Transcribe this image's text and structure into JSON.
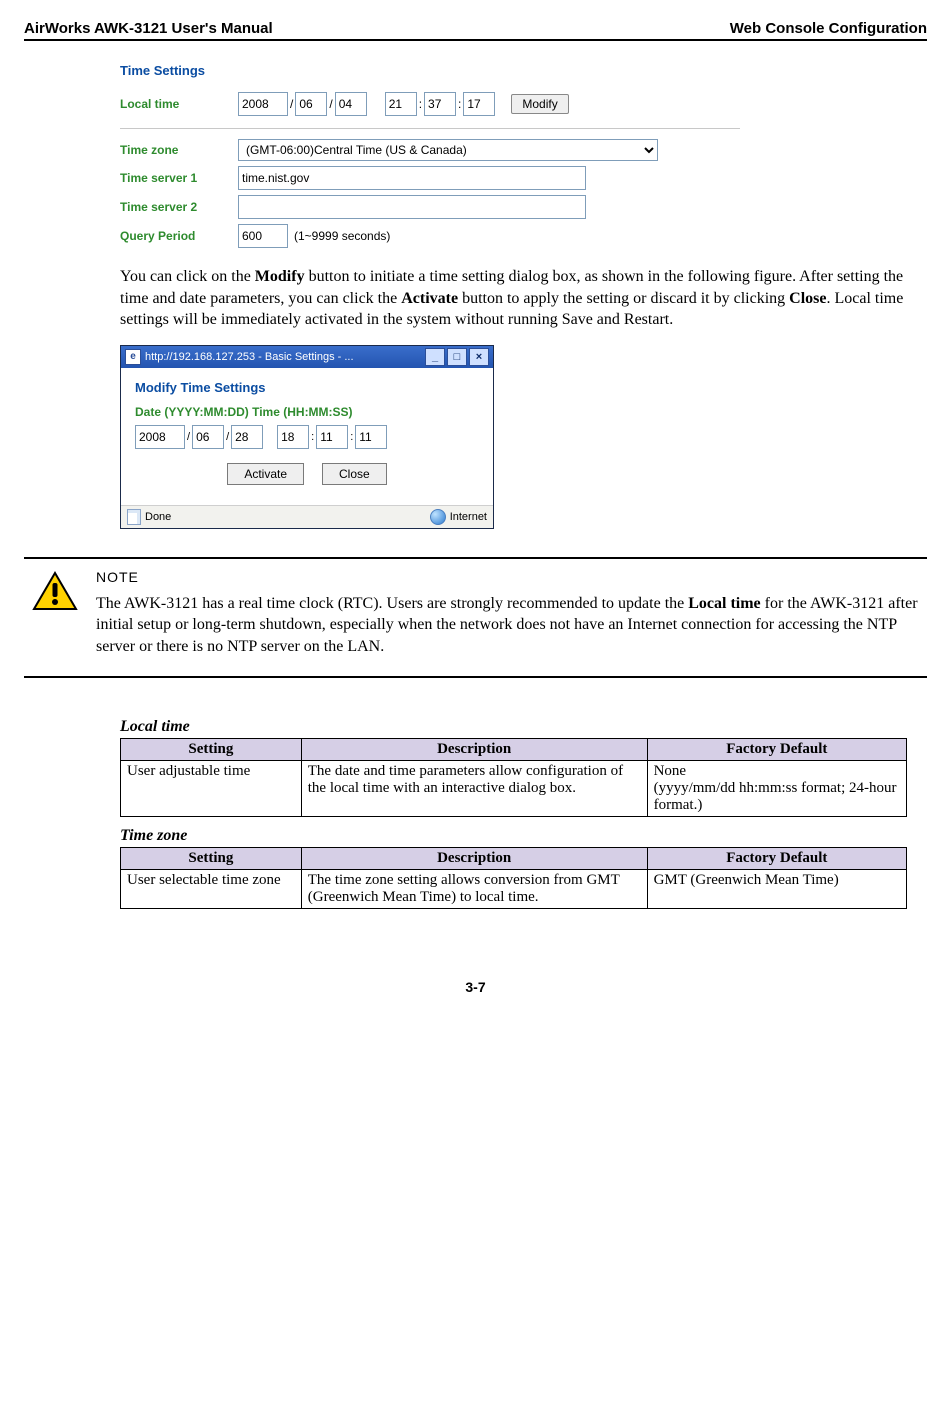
{
  "header": {
    "left": "AirWorks AWK-3121 User's Manual",
    "right": "Web Console Configuration"
  },
  "time_settings": {
    "title": "Time Settings",
    "local_time_label": "Local time",
    "date": {
      "y": "2008",
      "mo": "06",
      "d": "04"
    },
    "time": {
      "h": "21",
      "mi": "37",
      "s": "17"
    },
    "modify_btn": "Modify",
    "tz_label": "Time zone",
    "tz_value": "(GMT-06:00)Central Time (US & Canada)",
    "ts1_label": "Time server 1",
    "ts1_value": "time.nist.gov",
    "ts2_label": "Time server 2",
    "ts2_value": "",
    "qp_label": "Query Period",
    "qp_value": "600",
    "qp_hint": "(1~9999 seconds)"
  },
  "paragraph": "You can click on the Modify button to initiate a time setting dialog box, as shown in the following figure. After setting the time and date parameters, you can click the Activate button to apply the setting or discard it by clicking Close. Local time settings will be immediately activated in the system without running Save and Restart.",
  "paragraph_parts": {
    "p1": "You can click on the ",
    "b1": "Modify",
    "p2": " button to initiate a time setting dialog box, as shown in the following figure. After setting the time and date parameters, you can click the ",
    "b2": "Activate",
    "p3": " button to apply the setting or discard it by clicking ",
    "b3": "Close",
    "p4": ". Local time settings will be immediately activated in the system without running Save and Restart."
  },
  "dialog": {
    "url": "http://192.168.127.253 - Basic Settings - ...",
    "heading": "Modify Time Settings",
    "sub": "Date (YYYY:MM:DD) Time (HH:MM:SS)",
    "date": {
      "y": "2008",
      "mo": "06",
      "d": "28"
    },
    "time": {
      "h": "18",
      "mi": "11",
      "s": "11"
    },
    "activate": "Activate",
    "close": "Close",
    "status_left": "Done",
    "status_right": "Internet"
  },
  "note": {
    "title": "NOTE",
    "body_pre": "The AWK-3121 has a real time clock (RTC). Users are strongly recommended to update the ",
    "body_bold": "Local time",
    "body_post": " for the AWK-3121 after initial setup or long-term shutdown, especially when the network does not have an Internet connection for accessing the NTP server or there is no NTP server on the LAN."
  },
  "tables": {
    "headers": {
      "setting": "Setting",
      "desc": "Description",
      "def": "Factory Default"
    },
    "local_time": {
      "title": "Local time",
      "setting": "User adjustable time",
      "desc": "The date and time parameters allow configuration of the local time with an interactive dialog box.",
      "def": "None\n(yyyy/mm/dd hh:mm:ss format; 24-hour format.)"
    },
    "time_zone": {
      "title": "Time zone",
      "setting": "User selectable time zone",
      "desc": "The time zone setting allows conversion from GMT (Greenwich Mean Time) to local time.",
      "def": "GMT (Greenwich Mean Time)"
    }
  },
  "page_number": "3-7"
}
